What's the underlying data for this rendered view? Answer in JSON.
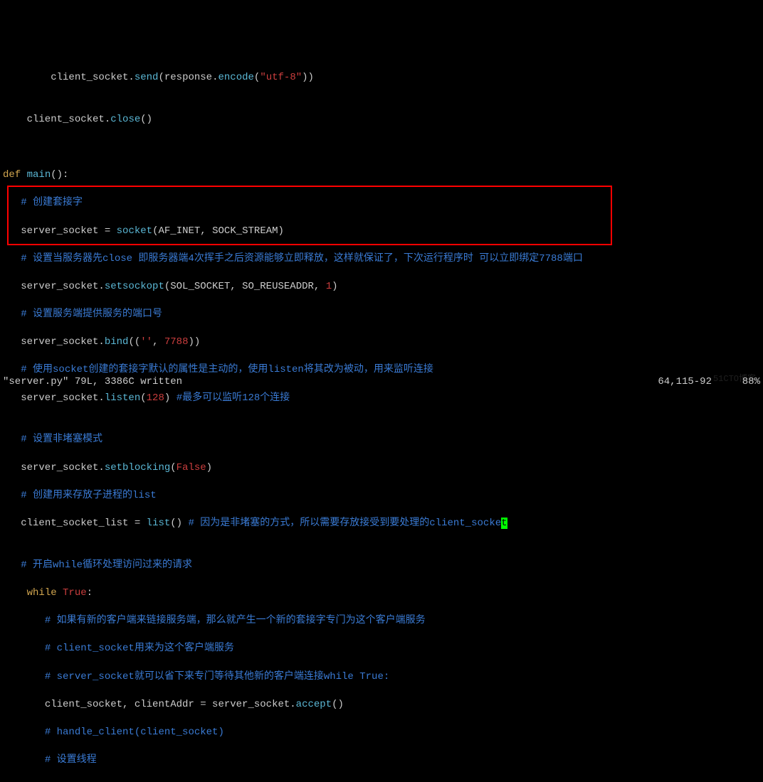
{
  "code": {
    "l1_fn": "send",
    "l1_arg": "response",
    "l1_fn2": "encode",
    "l1_str": "\"utf-8\"",
    "l2_fn": "close",
    "l3_kw": "def",
    "l3_name": "main",
    "l4_comment": "# 创建套接字",
    "l5_var": "server_socket",
    "l5_fn": "socket",
    "l5_a1": "AF_INET",
    "l5_a2": "SOCK_STREAM",
    "l6_comment": "# 设置当服务器先close 即服务器端4次挥手之后资源能够立即释放，这样就保证了，下次运行程序时 可以立即绑定7788端口",
    "l7_fn": "setsockopt",
    "l7_a1": "SOL_SOCKET",
    "l7_a2": "SO_REUSEADDR",
    "l7_a3": "1",
    "l8_comment": "# 设置服务端提供服务的端口号",
    "l9_fn": "bind",
    "l9_s": "''",
    "l9_n": "7788",
    "l10_comment": "# 使用socket创建的套接字默认的属性是主动的，使用listen将其改为被动，用来监听连接",
    "l11_fn": "listen",
    "l11_n": "128",
    "l11_comment": "#最多可以监听128个连接",
    "l13_comment": "# 设置非堵塞模式",
    "l14_fn": "setblocking",
    "l14_bool": "False",
    "l15_comment": "# 创建用来存放子进程的list",
    "l16_var": "client_socket_list",
    "l16_fn": "list",
    "l16_comment_a": "# 因为是非堵塞的方式，所以需要存放接受到要处理的client_socke",
    "l16_cursor": "t",
    "l18_comment": "# 开启while循环处理访问过来的请求",
    "l19_kw": "while",
    "l19_bool": "True",
    "l20_comment": "# 如果有新的客户端来链接服务端，那么就产生一个新的套接字专门为这个客户端服务",
    "l21_comment": "# client_socket用来为这个客户端服务",
    "l22_comment": "# server_socket就可以省下来专门等待其他新的客户端连接while True:",
    "l23_text": "client_socket, clientAddr = server_socket.",
    "l23_fn": "accept",
    "l24_comment": "# handle_client(client_socket)",
    "l25_comment": "# 设置线程"
  },
  "status": {
    "left": "\"server.py\" 79L, 3386C written",
    "pos": "64,115-92",
    "pct": "88%"
  },
  "watermark": "51CTO博客"
}
